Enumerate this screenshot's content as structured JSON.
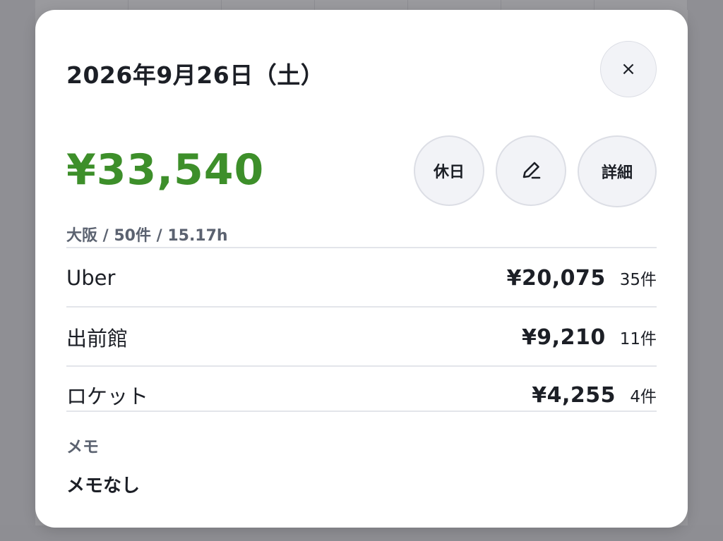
{
  "modal": {
    "date_title": "2026年9月26日（土）",
    "close_label": "×",
    "total_amount": "¥33,540",
    "actions": {
      "holiday_label": "休日",
      "edit_icon": "pencil-icon",
      "detail_label": "詳細"
    },
    "summary": "大阪 / 50件 / 15.17h",
    "platforms": [
      {
        "name": "Uber",
        "amount": "¥20,075",
        "count": "35件"
      },
      {
        "name": "出前館",
        "amount": "¥9,210",
        "count": "11件"
      },
      {
        "name": "ロケット",
        "amount": "¥4,255",
        "count": "4件"
      }
    ],
    "memo": {
      "label": "メモ",
      "text": "メモなし"
    }
  },
  "colors": {
    "accent_green": "#3d8f2a",
    "text_dark": "#1c1f26",
    "text_muted": "#5b6270",
    "button_bg": "#f2f3f7"
  }
}
